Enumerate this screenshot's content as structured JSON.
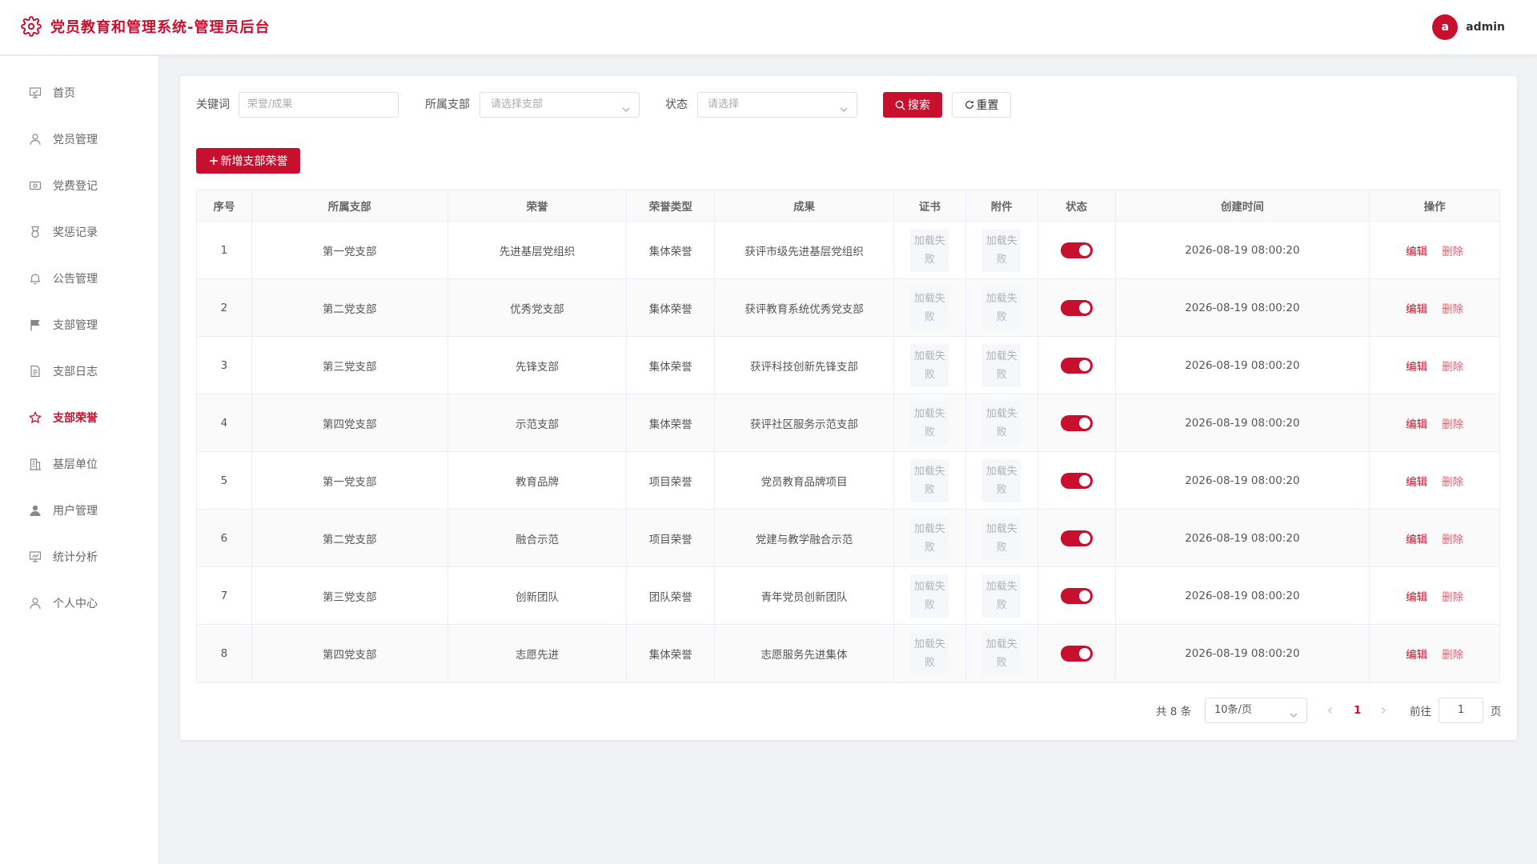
{
  "header": {
    "title": "党员教育和管理系统-管理员后台",
    "user": {
      "avatar_letter": "a",
      "name": "admin"
    }
  },
  "sidebar": {
    "items": [
      {
        "label": "首页",
        "icon": "home-icon",
        "active": false
      },
      {
        "label": "党员管理",
        "icon": "user-icon",
        "active": false
      },
      {
        "label": "党费登记",
        "icon": "money-icon",
        "active": false
      },
      {
        "label": "奖惩记录",
        "icon": "medal-icon",
        "active": false
      },
      {
        "label": "公告管理",
        "icon": "bell-icon",
        "active": false
      },
      {
        "label": "支部管理",
        "icon": "flag-icon",
        "active": false
      },
      {
        "label": "支部日志",
        "icon": "document-icon",
        "active": false
      },
      {
        "label": "支部荣誉",
        "icon": "star-icon",
        "active": true
      },
      {
        "label": "基层单位",
        "icon": "building-icon",
        "active": false
      },
      {
        "label": "用户管理",
        "icon": "user-filled-icon",
        "active": false
      },
      {
        "label": "统计分析",
        "icon": "presentation-icon",
        "active": false
      },
      {
        "label": "个人中心",
        "icon": "user-icon",
        "active": false
      }
    ]
  },
  "filters": {
    "keyword_label": "关键词",
    "keyword_placeholder": "荣誉/成果",
    "branch_label": "所属支部",
    "branch_placeholder": "请选择支部",
    "status_label": "状态",
    "status_placeholder": "请选择",
    "search_button": "搜索",
    "reset_button": "重置"
  },
  "toolbar": {
    "add_button": "新增支部荣誉"
  },
  "table": {
    "columns": [
      "序号",
      "所属支部",
      "荣誉",
      "荣誉类型",
      "成果",
      "证书",
      "附件",
      "状态",
      "创建时间",
      "操作"
    ],
    "image_fail_text": "加载失败",
    "edit_label": "编辑",
    "delete_label": "删除",
    "rows": [
      {
        "index": "1",
        "branch": "第一党支部",
        "honor": "先进基层党组织",
        "type": "集体荣誉",
        "result": "获评市级先进基层党组织",
        "status_on": true,
        "created": "2026-08-19 08:00:20"
      },
      {
        "index": "2",
        "branch": "第二党支部",
        "honor": "优秀党支部",
        "type": "集体荣誉",
        "result": "获评教育系统优秀党支部",
        "status_on": true,
        "created": "2026-08-19 08:00:20"
      },
      {
        "index": "3",
        "branch": "第三党支部",
        "honor": "先锋支部",
        "type": "集体荣誉",
        "result": "获评科技创新先锋支部",
        "status_on": true,
        "created": "2026-08-19 08:00:20"
      },
      {
        "index": "4",
        "branch": "第四党支部",
        "honor": "示范支部",
        "type": "集体荣誉",
        "result": "获评社区服务示范支部",
        "status_on": true,
        "created": "2026-08-19 08:00:20"
      },
      {
        "index": "5",
        "branch": "第一党支部",
        "honor": "教育品牌",
        "type": "项目荣誉",
        "result": "党员教育品牌项目",
        "status_on": true,
        "created": "2026-08-19 08:00:20"
      },
      {
        "index": "6",
        "branch": "第二党支部",
        "honor": "融合示范",
        "type": "项目荣誉",
        "result": "党建与教学融合示范",
        "status_on": true,
        "created": "2026-08-19 08:00:20"
      },
      {
        "index": "7",
        "branch": "第三党支部",
        "honor": "创新团队",
        "type": "团队荣誉",
        "result": "青年党员创新团队",
        "status_on": true,
        "created": "2026-08-19 08:00:20"
      },
      {
        "index": "8",
        "branch": "第四党支部",
        "honor": "志愿先进",
        "type": "集体荣誉",
        "result": "志愿服务先进集体",
        "status_on": true,
        "created": "2026-08-19 08:00:20"
      }
    ]
  },
  "pagination": {
    "total_text": "共 8 条",
    "page_size": "10条/页",
    "current_page": "1",
    "goto_label": "前往",
    "goto_value": "1",
    "page_suffix": "页"
  },
  "colors": {
    "brand": "#c8102e",
    "delete": "#e06070"
  }
}
